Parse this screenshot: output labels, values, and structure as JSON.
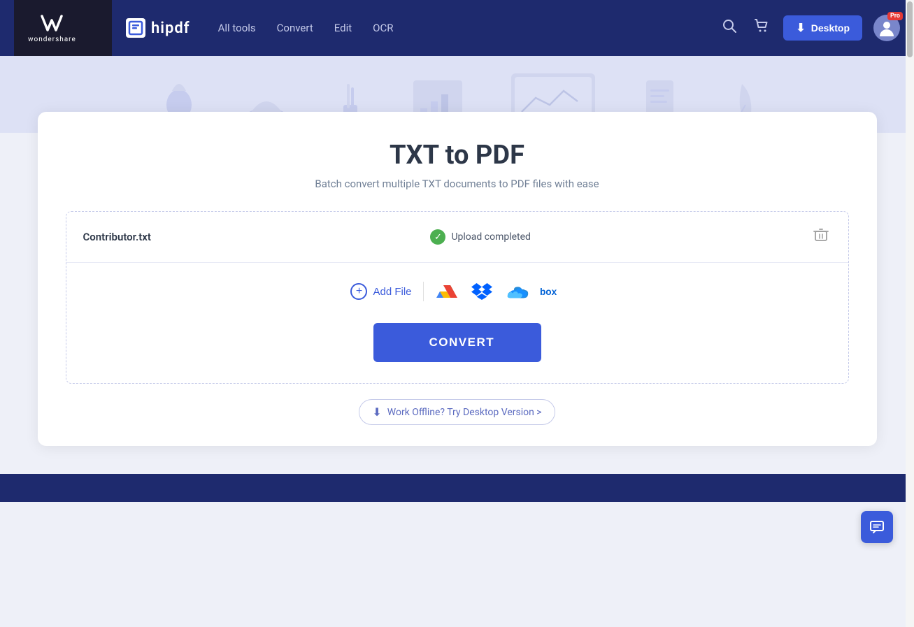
{
  "brand": {
    "wondershare_text": "wondershare",
    "hipdf_name": "hipdf"
  },
  "navbar": {
    "links": [
      {
        "label": "All tools",
        "id": "all-tools"
      },
      {
        "label": "Convert",
        "id": "convert"
      },
      {
        "label": "Edit",
        "id": "edit"
      },
      {
        "label": "OCR",
        "id": "ocr"
      }
    ],
    "desktop_button": "Desktop",
    "pro_badge": "Pro"
  },
  "page": {
    "title": "TXT to PDF",
    "subtitle": "Batch convert multiple TXT documents to PDF files with ease"
  },
  "file": {
    "name": "Contributor.txt",
    "status": "Upload completed"
  },
  "actions": {
    "add_file": "Add File",
    "convert": "CONVERT",
    "offline_link": "Work Offline? Try Desktop Version >"
  },
  "cloud_services": [
    {
      "name": "google-drive",
      "label": "Google Drive"
    },
    {
      "name": "dropbox",
      "label": "Dropbox"
    },
    {
      "name": "onedrive",
      "label": "OneDrive"
    },
    {
      "name": "box",
      "label": "Box"
    }
  ]
}
